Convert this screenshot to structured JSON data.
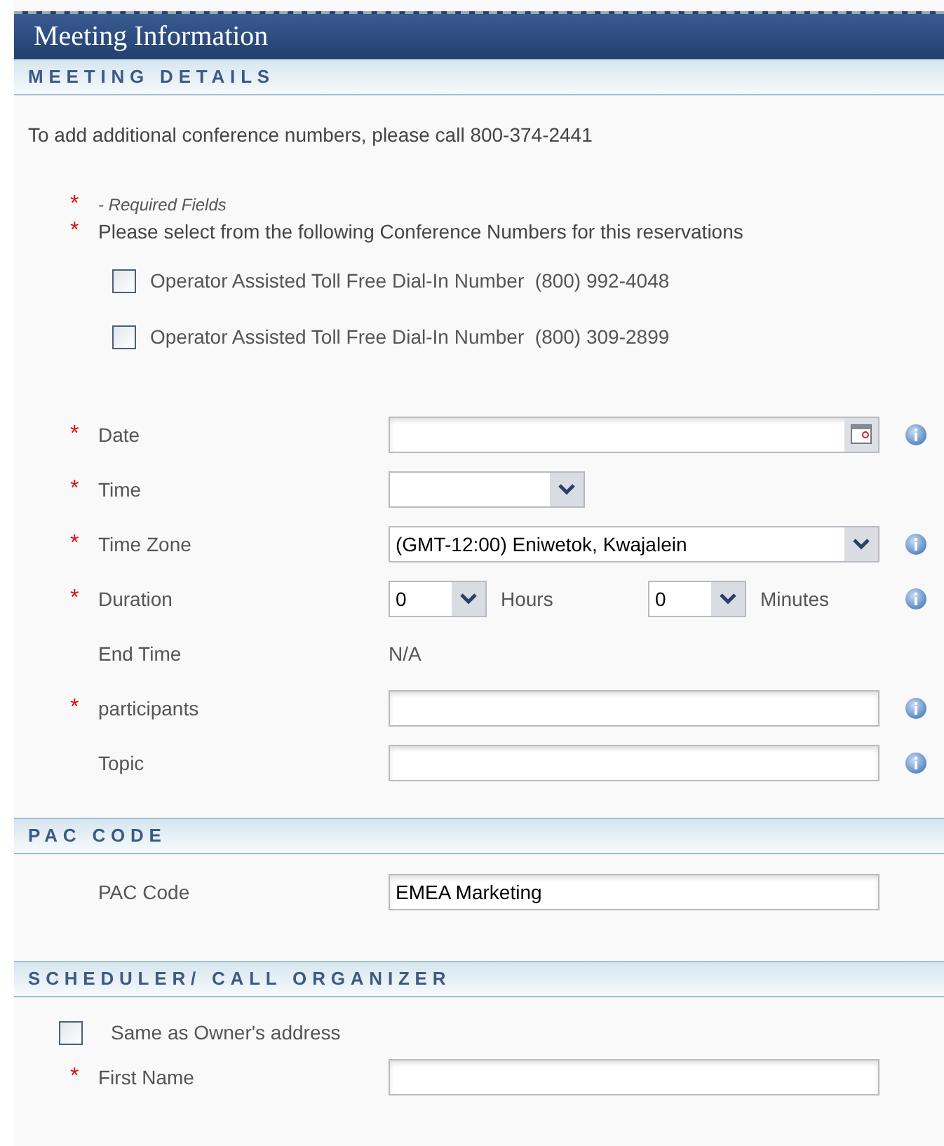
{
  "window": {
    "title": "Meeting Information"
  },
  "meeting_details": {
    "heading": "MEETING DETAILS",
    "note": "To add additional conference numbers, please call 800-374-2441",
    "legend_marker": "*",
    "required_legend": "- Required Fields",
    "prompt_marker": "*",
    "select_prompt": "Please select from the following Conference Numbers for this reservations",
    "conference_numbers": [
      {
        "label": "Operator Assisted Toll Free Dial-In Number  (800) 992-4048",
        "checked": false
      },
      {
        "label": "Operator Assisted Toll Free Dial-In Number  (800) 309-2899",
        "checked": false
      }
    ],
    "fields": [
      {
        "kind": "date",
        "marker": "*",
        "label": "Date",
        "info": true
      },
      {
        "kind": "select",
        "marker": "*",
        "label": "Time",
        "info": false,
        "wide": false
      },
      {
        "kind": "select",
        "marker": "*",
        "label": "Time Zone",
        "info": true,
        "wide": true,
        "value": "(GMT-12:00) Eniwetok, Kwajalein"
      },
      {
        "kind": "duration",
        "marker": "*",
        "label": "Duration",
        "info": true,
        "hours": "0",
        "hours_unit": "Hours",
        "minutes": "0",
        "minutes_unit": "Minutes"
      },
      {
        "kind": "static",
        "label": "End Time",
        "info": false,
        "value": "N/A"
      },
      {
        "kind": "text",
        "marker": "*",
        "label": "participants",
        "info": true
      },
      {
        "kind": "text",
        "label": "Topic",
        "info": true
      }
    ]
  },
  "pac_code": {
    "heading": "PAC CODE",
    "label": "PAC Code",
    "value": "EMEA Marketing"
  },
  "scheduler": {
    "heading": "SCHEDULER/ CALL ORGANIZER",
    "same_as_owner": {
      "label": "Same as Owner's address",
      "checked": false
    },
    "fields": [
      {
        "marker": "*",
        "label": "First Name"
      }
    ]
  }
}
